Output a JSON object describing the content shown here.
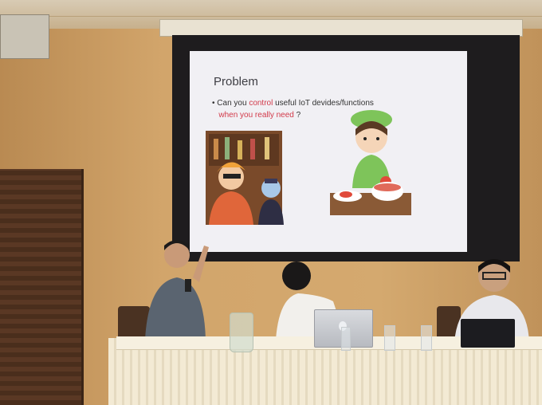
{
  "slide": {
    "title": "Problem",
    "bullet_prefix": "• Can you ",
    "bullet_highlight_1": "control",
    "bullet_mid": " useful IoT devides/functions",
    "bullet_highlight_2": "when you really need",
    "bullet_suffix": " ?"
  },
  "colors": {
    "wall": "#d2a56b",
    "slide_bg": "#f1f0f4",
    "highlight": "#d23a4a",
    "tablecloth": "#f3ead4"
  }
}
